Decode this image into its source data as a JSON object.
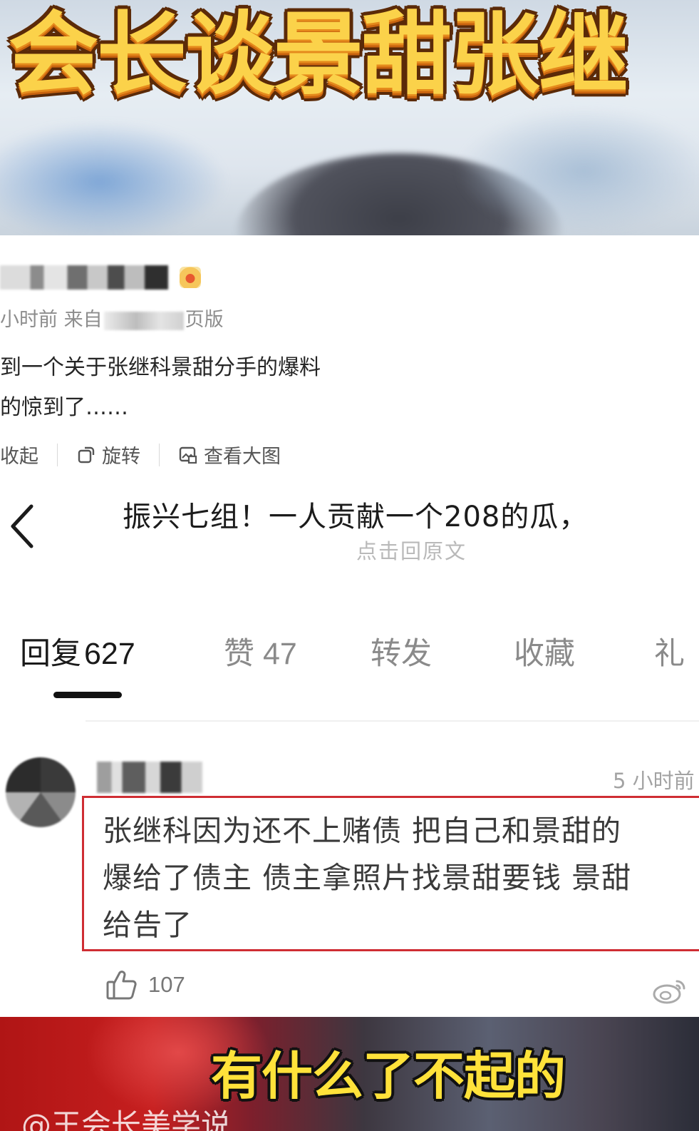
{
  "banner": {
    "title": "会长谈景甜张继"
  },
  "post": {
    "meta_time": "小时前",
    "meta_from": "来自",
    "meta_suffix": "页版",
    "text_line1": "到一个关于张继科景甜分手的爆料",
    "text_line2": "的惊到了……",
    "tool_collapse": "收起",
    "tool_rotate": "旋转",
    "tool_view_large": "查看大图"
  },
  "header": {
    "title": "振兴七组！一人贡献一个208的瓜，",
    "subtitle": "点击回原文"
  },
  "tabs": [
    {
      "label": "回复",
      "count": "627"
    },
    {
      "label": "赞",
      "count": "47"
    },
    {
      "label": "转发",
      "count": ""
    },
    {
      "label": "收藏",
      "count": ""
    },
    {
      "label": "礼",
      "count": ""
    }
  ],
  "comment": {
    "time": "5 小时前",
    "text_line1": "张继科因为还不上赌债 把自己和景甜的",
    "text_line2": "爆给了债主 债主拿照片找景甜要钱 景甜",
    "text_line3": "给告了",
    "like_count": "107",
    "highlight_color": "#cf2d33"
  },
  "bottom": {
    "caption": "有什么了不起的",
    "watermark": "@王会长美学说"
  },
  "icons": {
    "back": "chevron-left-icon",
    "rotate": "rotate-icon",
    "view_large": "image-icon",
    "like": "thumbs-up-icon",
    "share": "weibo-icon"
  }
}
